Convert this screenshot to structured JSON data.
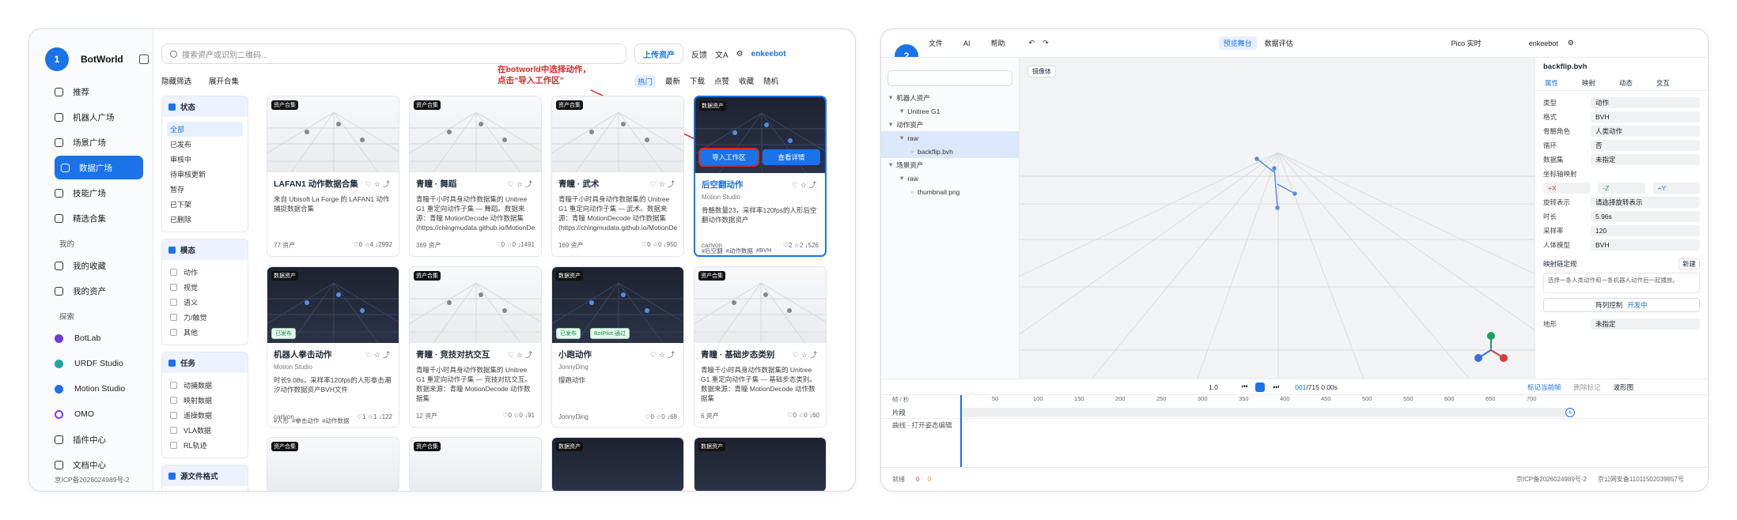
{
  "left": {
    "badge": "1",
    "brand": "BotWorld",
    "nav": [
      "推荐",
      "机器人广场",
      "场景广场",
      "数据广场",
      "技能广场",
      "精选合集"
    ],
    "my_title": "我的",
    "my": [
      "我的收藏",
      "我的资产"
    ],
    "explore_title": "探索",
    "explore": [
      "BotLab",
      "URDF Studio",
      "Motion Studio",
      "OMO",
      "插件中心",
      "文档中心"
    ],
    "icp": "京ICP备2026024989号-2",
    "search_placeholder": "搜索资产或识别二维码...",
    "upload": "上传资产",
    "feedback": "反馈",
    "user": "enkeebot",
    "hide_filter": "隐藏筛选",
    "expand_collection": "展开合集",
    "annotation_line1": "在botworld中选择动作，",
    "annotation_line2": "点击“导入工作区”",
    "sort": [
      "热门",
      "最新",
      "下载",
      "点赞",
      "收藏",
      "随机"
    ],
    "status_title": "状态",
    "status": [
      "全部",
      "已发布",
      "审核中",
      "待审核更新",
      "暂存",
      "已下架",
      "已删除"
    ],
    "modality_title": "模态",
    "modality": [
      "动作",
      "视觉",
      "语义",
      "力/触觉",
      "其他"
    ],
    "task_title": "任务",
    "task": [
      "动捕数据",
      "映射数据",
      "遥操数据",
      "VLA数据",
      "RL轨迹"
    ],
    "source_title": "源文件格式",
    "cards": [
      {
        "tag": "资产合集",
        "title": "LAFAN1 动作数据合集",
        "desc": "来自 Ubisoft La Forge 的 LAFAN1 动作捕捉数据合集",
        "meta_l": "77 资产",
        "c": "0",
        "f": "4",
        "d": "2992"
      },
      {
        "tag": "资产合集",
        "title": "青瞳 · 舞蹈",
        "desc": "青瞳千小时具身动作数据集的 Unitree G1 重定向动作子集 — 舞蹈。数据来源：青瞳 MotionDecode 动作数据集 (https://chingmudata.github.io/MotionDecode/、HuggingFace...",
        "meta_l": "369 资产",
        "c": "0",
        "f": "0",
        "d": "1491"
      },
      {
        "tag": "资产合集",
        "title": "青瞳 · 武术",
        "desc": "青瞳千小时具身动作数据集的 Unitree G1 重定向动作子集 — 武术。数据来源：青瞳 MotionDecode 动作数据集 (https://chingmudata.github.io/MotionDecode/、HuggingFace...",
        "meta_l": "169 资产",
        "c": "0",
        "f": "0",
        "d": "950"
      },
      {
        "tag": "数据资产",
        "title": "后空翻动作",
        "sub": "Motion Studio",
        "desc": "骨骼数量23，采样率120fps的人形后空翻动作数据资产",
        "chips": [
          "#后空翻",
          "#动作数据",
          "#BVH"
        ],
        "meta_l": "carlvon",
        "c": "2",
        "f": "2",
        "d": "526",
        "btn1": "导入工作区",
        "btn2": "查看详情"
      },
      {
        "tag": "数据资产",
        "title": "机器人拳击动作",
        "sub": "Motion Studio",
        "desc": "时长9.08s，采样率120fps的人形拳击潮汐动作数据资产BVH文件",
        "chips": [
          "#人形",
          "#拳击动作",
          "#动作数据"
        ],
        "meta_l": "carlvon",
        "c": "1",
        "f": "1",
        "d": "122",
        "badge": "已发布"
      },
      {
        "tag": "资产合集",
        "title": "青瞳 · 竞技对抗交互",
        "desc": "青瞳千小时具身动作数据集的 Unitree G1 重定向动作子集 — 竞技对抗交互。数据来源：青瞳 MotionDecode 动作数据集 (https://chingmudata.github.io/MotionDecode/、HuggingFace...",
        "meta_l": "12 资产",
        "c": "0",
        "f": "0",
        "d": "91"
      },
      {
        "tag": "数据资产",
        "title": "小跑动作",
        "sub": "JonnyDing",
        "desc": "慢跑动作",
        "meta_l": "JonnyDing",
        "c": "0",
        "f": "0",
        "d": "68",
        "badge": "已发布",
        "badge2": "BotPilot 通过"
      },
      {
        "tag": "资产合集",
        "title": "青瞳 · 基础步态类别",
        "desc": "青瞳千小时具身动作数据集的 Unitree G1 重定向动作子集 — 基础步态类别。数据来源：青瞳 MotionDecode 动作数据集 (https://chingmudata.github.io/MotionDecode/、HuggingFace...",
        "meta_l": "6 资产",
        "c": "0",
        "f": "0",
        "d": "60"
      }
    ],
    "more_tags": [
      "资产合集",
      "资产合集",
      "数据资产",
      "数据资产"
    ]
  },
  "right": {
    "badge": "2",
    "menu": [
      "文件",
      "AI",
      "帮助"
    ],
    "tabs": [
      "预览舞台",
      "数据评估"
    ],
    "pico": "Pico 实时",
    "user": "enkeebot",
    "tree": [
      {
        "label": "机器人资产",
        "level": 0
      },
      {
        "label": "Unitree G1",
        "level": 1
      },
      {
        "label": "动作资产",
        "level": 0
      },
      {
        "label": "raw",
        "level": 1
      },
      {
        "label": "backflip.bvh",
        "level": 2
      },
      {
        "label": "场景资产",
        "level": 0
      },
      {
        "label": "raw",
        "level": 1
      },
      {
        "label": "thumbnail.png",
        "level": 2
      }
    ],
    "vp_label": "镜像体",
    "file": "backflip.bvh",
    "prop_tabs": [
      "属性",
      "映射",
      "动态",
      "交互"
    ],
    "props": [
      {
        "k": "类型",
        "v": "动作"
      },
      {
        "k": "格式",
        "v": "BVH"
      },
      {
        "k": "骨骼角色",
        "v": "人类动作"
      },
      {
        "k": "循环",
        "v": "否"
      },
      {
        "k": "数据集",
        "v": "未指定"
      }
    ],
    "coord_title": "坐标轴映射",
    "coords": [
      "+X",
      "-Z",
      "+Y"
    ],
    "props2": [
      {
        "k": "旋转表示",
        "v": "请选择旋转表示"
      },
      {
        "k": "时长",
        "v": "5.96s"
      },
      {
        "k": "采样率",
        "v": "120"
      },
      {
        "k": "人体模型",
        "v": "BVH"
      }
    ],
    "retarget_title": "映射链定规",
    "retarget_new": "新建",
    "retarget_hint": "选择一条人类动作和一条机器人动作后一起播放。",
    "control_btn": "阵列控制",
    "dev": "开发中",
    "ground_k": "地形",
    "ground_v": "未指定",
    "frame": "001",
    "frame_total": "/715 0.00s",
    "speed": "1.0",
    "tl_unit": "帧 / 秒",
    "ticks": [
      "50",
      "100",
      "150",
      "200",
      "250",
      "300",
      "350",
      "400",
      "450",
      "500",
      "550",
      "600",
      "650",
      "700"
    ],
    "tl_rows": [
      "片段",
      "曲线 · 打开姿态编辑"
    ],
    "tl_btns": [
      "标记当前帧",
      "删除标记",
      "波形图"
    ],
    "status_left": "就绪",
    "err": "0",
    "warn": "0",
    "icp": "京ICP备2026024989号-2",
    "ga": "京公网安备11011502039857号"
  }
}
